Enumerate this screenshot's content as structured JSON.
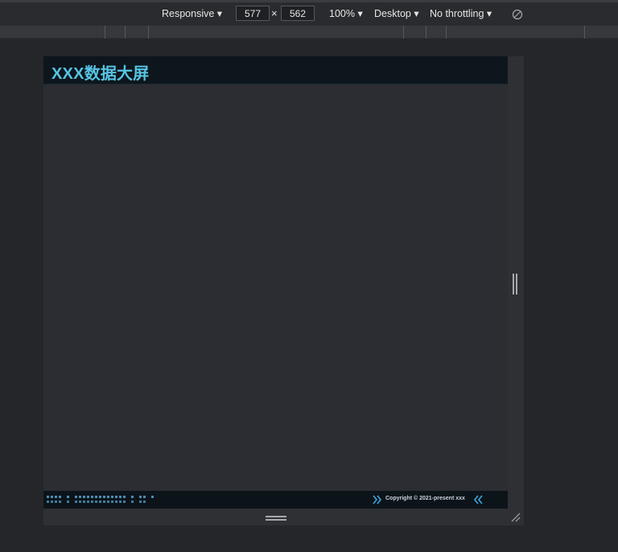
{
  "toolbar": {
    "device": "Responsive ▾",
    "width": "577",
    "times": "×",
    "height": "562",
    "zoom": "100% ▾",
    "mode": "Desktop ▾",
    "throttling": "No throttling ▾",
    "rotate_icon": "rotate-icon"
  },
  "page": {
    "title": "XXX数据大屏",
    "footer": {
      "copyright": "Copyright © 2021-present xxx",
      "left_icon": "double-chevron-right-icon",
      "right_icon": "double-chevron-left-icon"
    },
    "colors": {
      "accent": "#57c3e3",
      "header_bg": "#0d161c",
      "page_bg": "#2c2d32",
      "dot_color": "#4f93bb"
    }
  }
}
